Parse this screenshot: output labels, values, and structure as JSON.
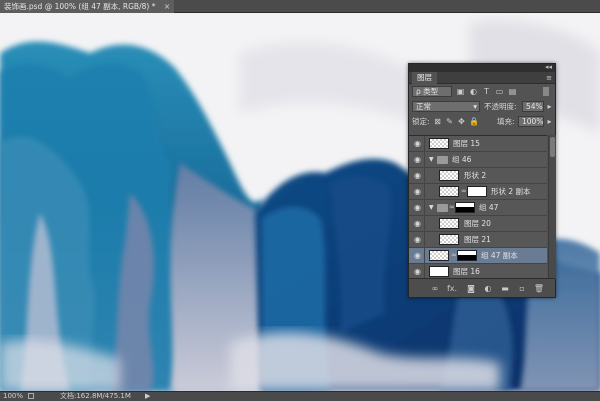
{
  "document_tab": {
    "title": "装饰画.psd @ 100% (组 47 副本, RGB/8) *",
    "close": "×"
  },
  "status_bar": {
    "zoom": "100%",
    "doc_info": "文档:162.8M/475.1M",
    "arrow": "▶"
  },
  "colors": {
    "canvas_bg": "#f2f2f4",
    "teal_light": "#1e8fb5",
    "teal_deep": "#0d5d8c",
    "navy": "#123a72",
    "lavender": "#8a86a8",
    "selected_layer": "#6a7c93"
  },
  "layers_panel": {
    "tab_label": "图层",
    "collapse_icon": "◂◂",
    "menu_icon": "≡",
    "filter": {
      "label": "ρ 类型",
      "icons": [
        "image-icon",
        "adjust-icon",
        "text-icon",
        "shape-icon",
        "smart-object-icon"
      ]
    },
    "blend_mode": "正常",
    "opacity_label": "不透明度:",
    "opacity_value": "54%",
    "lock_label": "锁定:",
    "fill_label": "填充:",
    "fill_value": "100%",
    "layers": [
      {
        "name": "图层 15",
        "type": "pixel",
        "indent": 0,
        "selected": false
      },
      {
        "name": "组 46",
        "type": "group",
        "indent": 0,
        "selected": false
      },
      {
        "name": "形状 2",
        "type": "pixel",
        "indent": 1,
        "selected": false
      },
      {
        "name": "形状 2 副本",
        "type": "masked",
        "indent": 1,
        "selected": false
      },
      {
        "name": "组 47",
        "type": "group-masked",
        "indent": 0,
        "selected": false
      },
      {
        "name": "图层 20",
        "type": "pixel",
        "indent": 1,
        "selected": false
      },
      {
        "name": "图层 21",
        "type": "pixel",
        "indent": 1,
        "selected": false
      },
      {
        "name": "组 47 副本",
        "type": "masked-selected",
        "indent": 0,
        "selected": true
      },
      {
        "name": "图层 16",
        "type": "white",
        "indent": 0,
        "selected": false
      }
    ],
    "footer_icons": [
      "link-icon",
      "fx-icon",
      "mask-icon",
      "adjustment-icon",
      "new-group-icon",
      "new-layer-icon",
      "trash-icon"
    ],
    "footer_fx": "fx."
  }
}
